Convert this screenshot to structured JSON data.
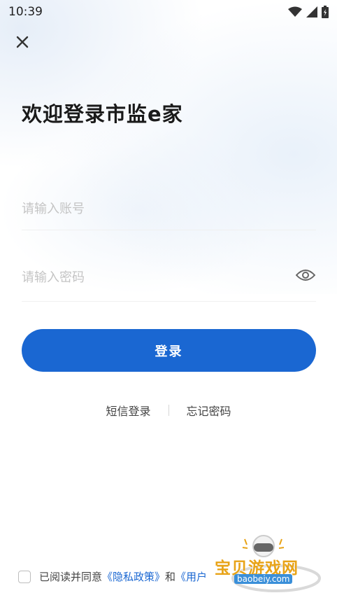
{
  "status_bar": {
    "time": "10:39"
  },
  "page": {
    "title": "欢迎登录市监e家"
  },
  "form": {
    "account_placeholder": "请输入账号",
    "password_placeholder": "请输入密码"
  },
  "login_button_label": "登录",
  "links": {
    "sms_login": "短信登录",
    "forgot_password": "忘记密码"
  },
  "agreement": {
    "prefix": "已阅读并同意",
    "privacy": "《隐私政策》",
    "and": "和",
    "user_agreement": "《用户"
  },
  "watermark": {
    "text": "宝贝游戏网",
    "url": "baobeiy.com"
  },
  "colors": {
    "accent": "#1a67d2",
    "placeholder": "#c4c4c4"
  }
}
